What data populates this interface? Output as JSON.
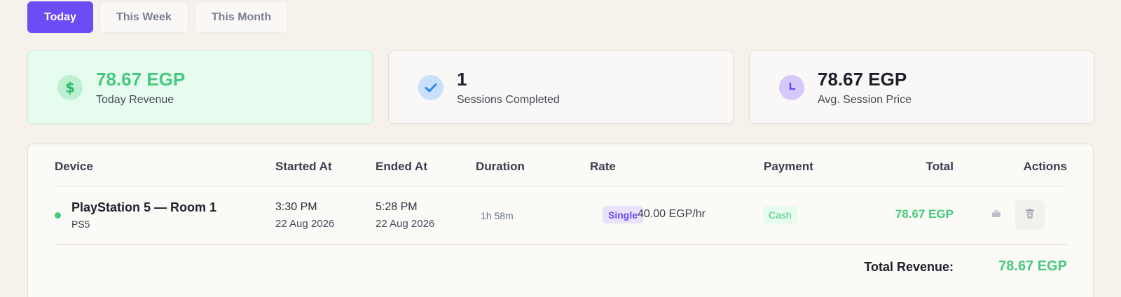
{
  "filters": {
    "tabs": [
      "Today",
      "This Week",
      "This Month"
    ],
    "active": "Today"
  },
  "stats": [
    {
      "value": "78.67 EGP",
      "label": "Today Revenue",
      "icon": "dollar-icon"
    },
    {
      "value": "1",
      "label": "Sessions Completed",
      "icon": "check-icon"
    },
    {
      "value": "78.67 EGP",
      "label": "Avg. Session Price",
      "icon": "clock-icon"
    }
  ],
  "table": {
    "headers": [
      "Device",
      "Started At",
      "Ended At",
      "Duration",
      "Rate",
      "Payment",
      "Total",
      "Actions"
    ],
    "rows": [
      {
        "device_name": "PlayStation 5 — Room 1",
        "device_type": "PS5",
        "start_time": "3:30 PM",
        "start_date": "22 Aug 2026",
        "end_time": "5:28 PM",
        "end_date": "22 Aug 2026",
        "duration": "1h 58m",
        "rate_type": "Single",
        "rate": "40.00 EGP/hr",
        "payment": "Cash",
        "total": "78.67 EGP",
        "actions": [
          "receipt-icon",
          "trash-icon"
        ]
      }
    ]
  },
  "summary": {
    "label": "Total Revenue:",
    "value": "78.67 EGP"
  },
  "colors": {
    "accent": "#6c4cf4",
    "success": "#47c97e",
    "background": "#f6f1ea"
  }
}
